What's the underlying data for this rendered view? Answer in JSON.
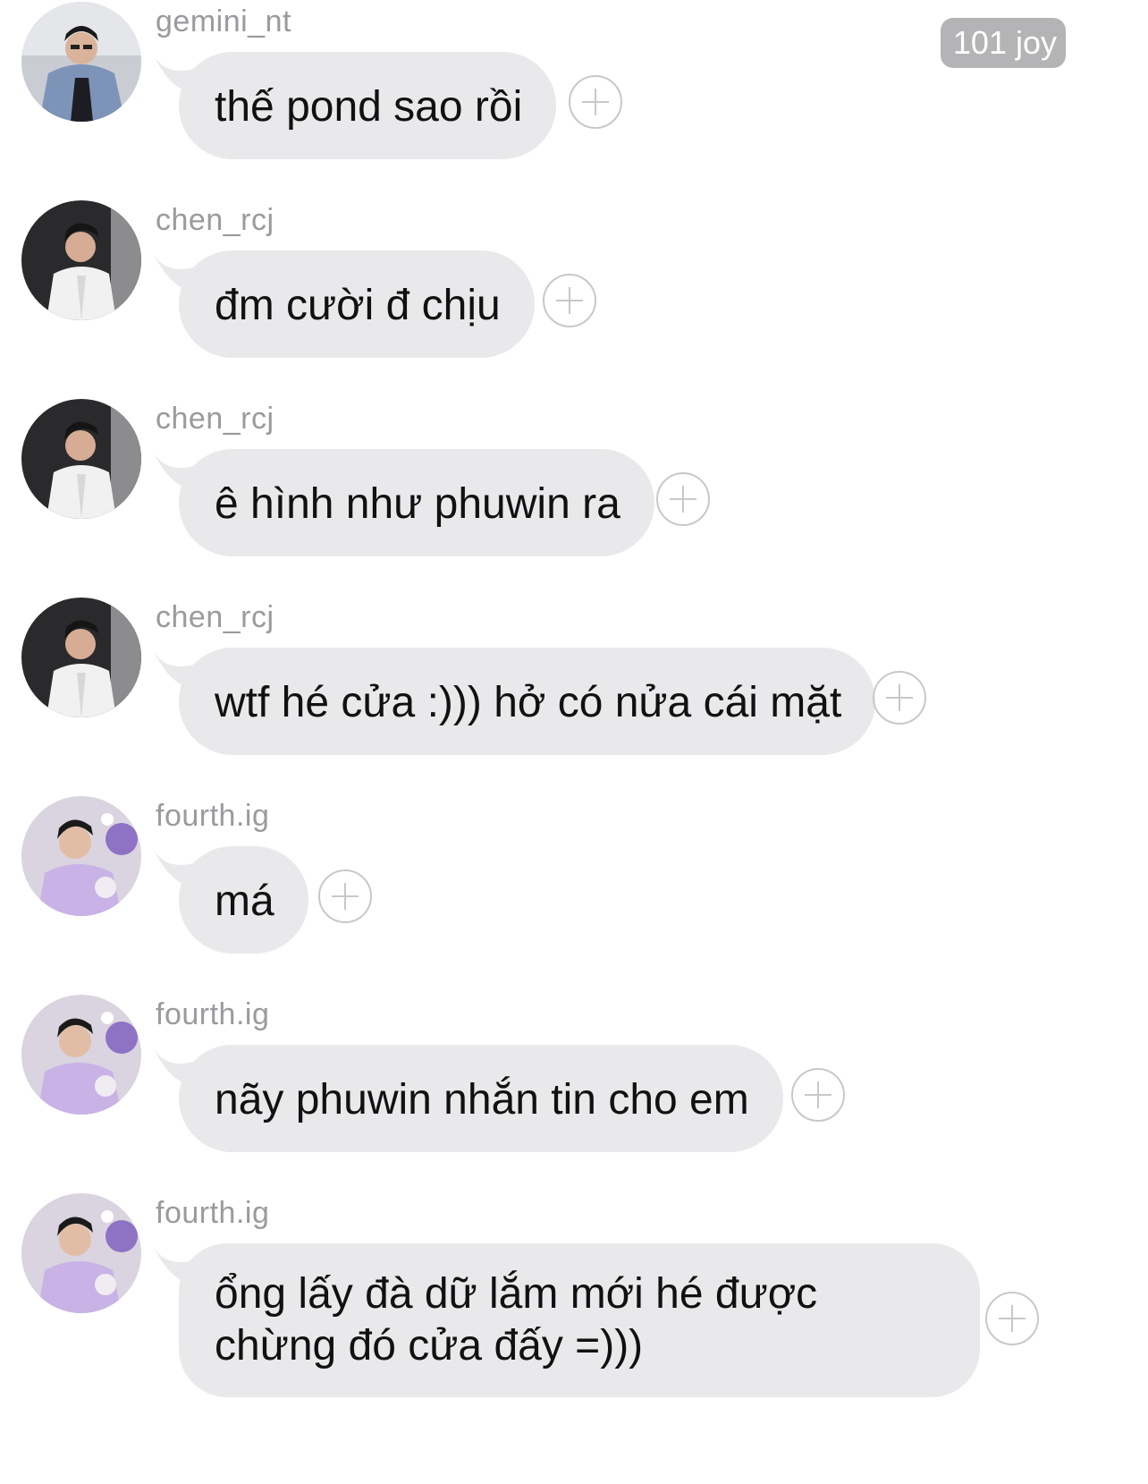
{
  "header": {
    "count_badge": "101 joy"
  },
  "messages": [
    {
      "username": "gemini_nt",
      "avatar": "avatar-gemini",
      "text": "thế pond sao rồi"
    },
    {
      "username": "chen_rcj",
      "avatar": "avatar-chen",
      "text": "đm cười đ chịu"
    },
    {
      "username": "chen_rcj",
      "avatar": "avatar-chen",
      "text": "ê hình như phuwin ra"
    },
    {
      "username": "chen_rcj",
      "avatar": "avatar-chen",
      "text": "wtf hé cửa :))) hở có nửa cái mặt"
    },
    {
      "username": "fourth.ig",
      "avatar": "avatar-fourth",
      "text": "má"
    },
    {
      "username": "fourth.ig",
      "avatar": "avatar-fourth",
      "text": "nãy phuwin nhắn tin cho em"
    },
    {
      "username": "fourth.ig",
      "avatar": "avatar-fourth",
      "text": "ổng lấy đà dữ lắm mới hé được chừng đó cửa đấy =)))"
    }
  ],
  "colors": {
    "bubble": "#e9e9eb",
    "username": "#9a9a9f",
    "badge": "#b4b4b6",
    "add_icon": "#c8c8cc"
  }
}
